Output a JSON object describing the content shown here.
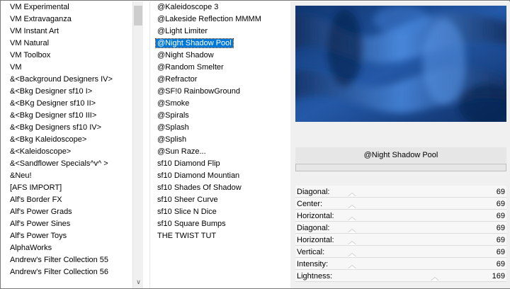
{
  "categories": {
    "items": [
      "VM Experimental",
      "VM Extravaganza",
      "VM Instant Art",
      "VM Natural",
      "VM Toolbox",
      "VM",
      "&<Background Designers IV>",
      "&<Bkg Designer sf10 I>",
      "&<BKg Designer sf10 II>",
      "&<Bkg Designer sf10 III>",
      "&<Bkg Designers sf10 IV>",
      "&<Bkg Kaleidoscope>",
      "&<Kaleidoscope>",
      "&<Sandflower Specials^v^ >",
      "&Neu!",
      "[AFS IMPORT]",
      "Alf's Border FX",
      "Alf's Power Grads",
      "Alf's Power Sines",
      "Alf's Power Toys",
      "AlphaWorks",
      "Andrew's Filter Collection 55",
      "Andrew's Filter Collection 56"
    ]
  },
  "filters": {
    "selected_index": 3,
    "items": [
      "@Kaleidoscope 3",
      "@Lakeside Reflection MMMM",
      "@Light Limiter",
      "@Night Shadow Pool",
      "@Night Shadow",
      "@Random Smelter",
      "@Refractor",
      "@SF!0 RainbowGround",
      "@Smoke",
      "@Spirals",
      "@Splash",
      "@Splish",
      "@Sun Raze...",
      "sf10 Diamond Flip",
      "sf10 Diamond Mountian",
      "sf10 Shades Of Shadow",
      "sf10 Sheer Curve",
      "sf10 Slice N Dice",
      "sf10 Square Bumps",
      "THE TWIST TUT"
    ]
  },
  "panel": {
    "filter_name": "@Night Shadow Pool",
    "sliders": [
      {
        "label": "Diagonal:",
        "value": "69",
        "fraction": 0.27
      },
      {
        "label": "Center:",
        "value": "69",
        "fraction": 0.27
      },
      {
        "label": "Horizontal:",
        "value": "69",
        "fraction": 0.27
      },
      {
        "label": "Diagonal:",
        "value": "69",
        "fraction": 0.27
      },
      {
        "label": "Horizontal:",
        "value": "69",
        "fraction": 0.27
      },
      {
        "label": "Vertical:",
        "value": "69",
        "fraction": 0.27
      },
      {
        "label": "Intensity:",
        "value": "69",
        "fraction": 0.27
      },
      {
        "label": "Lightness:",
        "value": "169",
        "fraction": 0.66
      }
    ]
  },
  "colors": {
    "selection": "#0078d7",
    "preview_dark": "#0d2a5c",
    "preview_light": "#3a78d0"
  }
}
